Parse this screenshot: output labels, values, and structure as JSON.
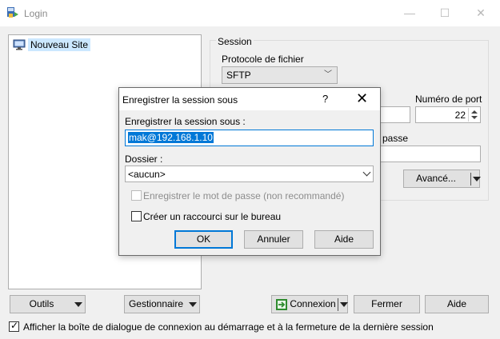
{
  "window": {
    "title": "Login"
  },
  "site_tree": {
    "items": [
      {
        "label": "Nouveau Site"
      }
    ]
  },
  "session": {
    "group_label": "Session",
    "protocol_label": "Protocole de fichier",
    "protocol_value": "SFTP",
    "port_label": "Numéro de port",
    "port_value": "22",
    "password_label_partial": "passe",
    "advanced_label": "Avancé..."
  },
  "dialog": {
    "title": "Enregistrer la session sous",
    "help": "?",
    "name_label": "Enregistrer la session sous :",
    "name_value": "mak@192.168.1.10",
    "folder_label": "Dossier :",
    "folder_value": "<aucun>",
    "save_password_label": "Enregistrer le mot de passe (non recommandé)",
    "shortcut_label": "Créer un raccourci sur le bureau",
    "ok": "OK",
    "cancel": "Annuler",
    "help_button": "Aide"
  },
  "bottom": {
    "tools": "Outils",
    "manager": "Gestionnaire",
    "connect": "Connexion",
    "close": "Fermer",
    "help": "Aide",
    "show_dialog_label": "Afficher la boîte de dialogue de connexion au démarrage et à la fermeture de la dernière session"
  }
}
